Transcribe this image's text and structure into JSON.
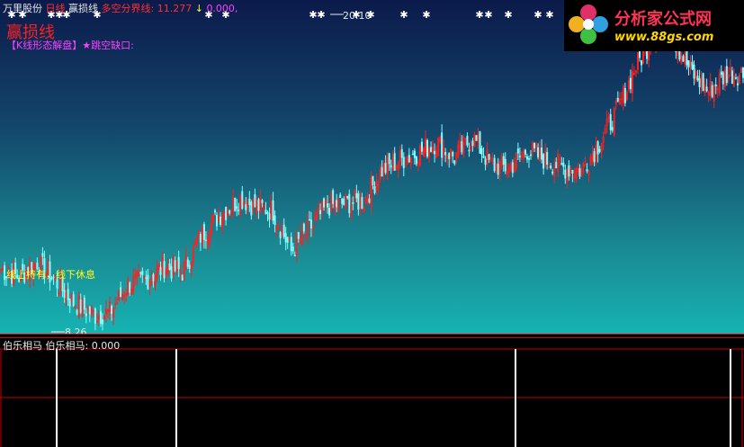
{
  "header": {
    "stock_name": "万里股份",
    "period": "日线",
    "indicator_name": "赢损线",
    "split_label": "多空分界线:",
    "split_value": "11.277",
    "arrow": "↓",
    "extra_value": "0.000,"
  },
  "main": {
    "big_title": "赢损线",
    "signal_label": "【K线形态解盘】★跳空缺口:",
    "note": "线上持有，线下休息",
    "high_label": "20.10",
    "low_label": "8.26"
  },
  "sub": {
    "name": "伯乐相马",
    "value_label": "伯乐相马: 0.000"
  },
  "logo": {
    "line1": "分析家公式网",
    "line2": "www.88gs.com"
  },
  "colors": {
    "up": "#ff2020",
    "down": "#80ffff",
    "panel_top": "#0b1a4a",
    "panel_bottom": "#16b3b3"
  },
  "chart_data": {
    "type": "candlestick",
    "y_range": [
      7.8,
      20.4
    ],
    "x_count": 410,
    "anchors": [
      [
        0,
        10.3
      ],
      [
        10,
        10.0
      ],
      [
        20,
        10.6
      ],
      [
        28,
        10.0
      ],
      [
        40,
        9.0
      ],
      [
        52,
        8.5
      ],
      [
        60,
        8.6
      ],
      [
        70,
        9.7
      ],
      [
        80,
        9.9
      ],
      [
        90,
        10.4
      ],
      [
        100,
        10.2
      ],
      [
        110,
        11.6
      ],
      [
        120,
        12.4
      ],
      [
        132,
        13.1
      ],
      [
        140,
        12.8
      ],
      [
        150,
        12.6
      ],
      [
        160,
        11.0
      ],
      [
        170,
        11.9
      ],
      [
        180,
        12.8
      ],
      [
        190,
        12.9
      ],
      [
        200,
        13.0
      ],
      [
        210,
        14.2
      ],
      [
        220,
        14.6
      ],
      [
        230,
        14.9
      ],
      [
        240,
        15.3
      ],
      [
        250,
        14.7
      ],
      [
        260,
        15.5
      ],
      [
        270,
        14.4
      ],
      [
        280,
        14.3
      ],
      [
        290,
        15.0
      ],
      [
        300,
        14.6
      ],
      [
        310,
        14.3
      ],
      [
        320,
        14.2
      ],
      [
        330,
        15.3
      ],
      [
        340,
        16.6
      ],
      [
        350,
        18.3
      ],
      [
        360,
        19.5
      ],
      [
        366,
        20.1
      ],
      [
        372,
        19.2
      ],
      [
        380,
        18.1
      ],
      [
        390,
        17.3
      ],
      [
        400,
        18.0
      ],
      [
        410,
        18.0
      ]
    ],
    "marker_bars": [
      63,
      196,
      573,
      812
    ],
    "sub_value": 0.0
  }
}
